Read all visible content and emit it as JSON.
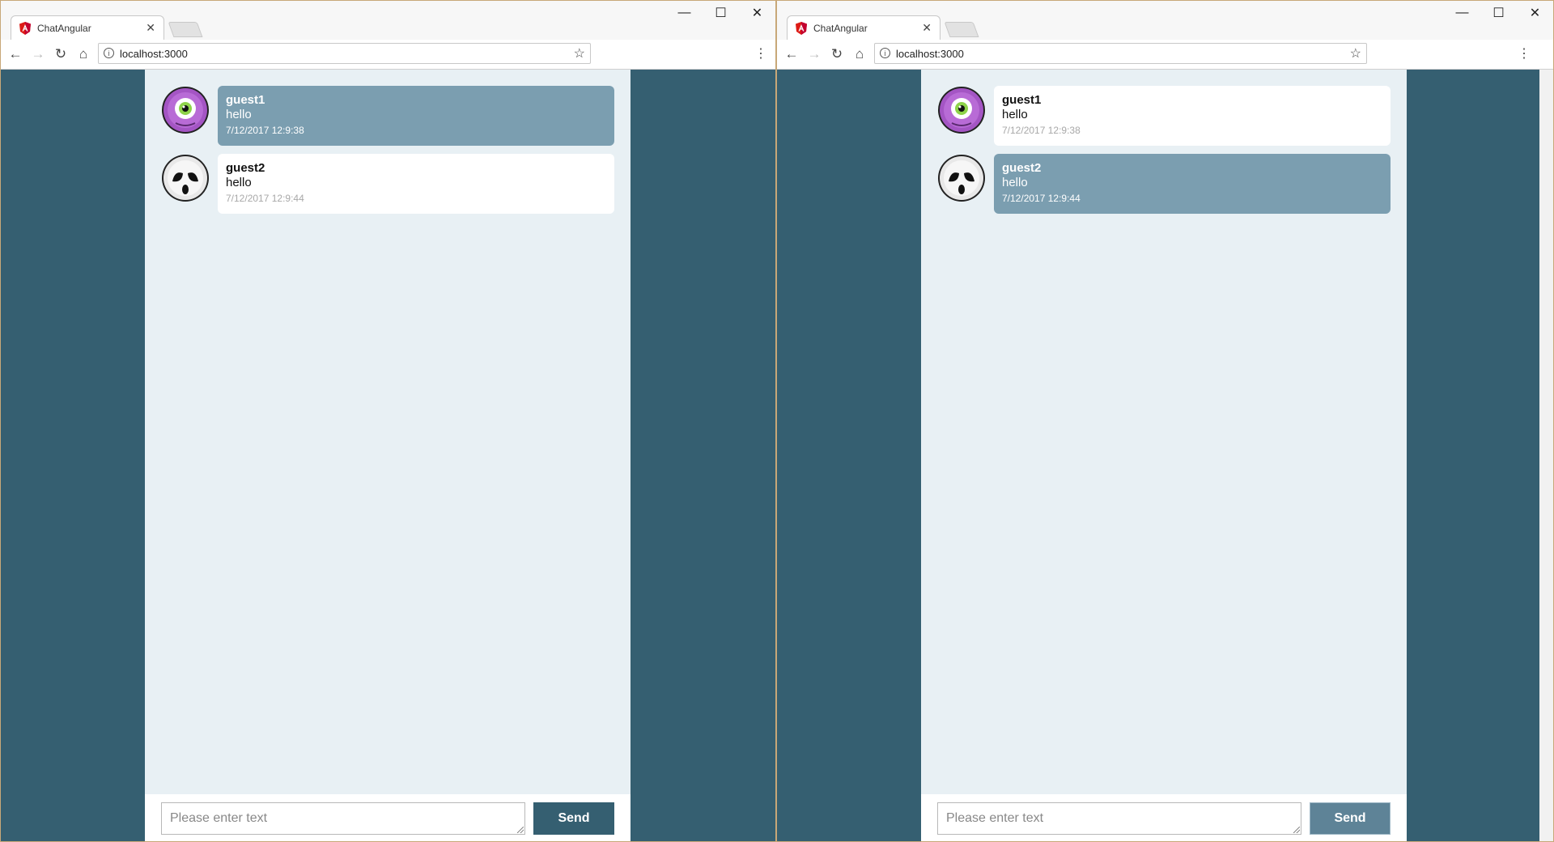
{
  "colors": {
    "page_background": "#355f71",
    "chat_background": "#e8f0f4",
    "own_bubble": "#7b9eb0",
    "other_bubble": "#ffffff",
    "send_button_dark": "#355f71",
    "send_button_light": "#5e8397"
  },
  "windows": [
    {
      "tab": {
        "title": "ChatAngular",
        "icon": "angular-logo-icon"
      },
      "address": {
        "url": "localhost:3000"
      },
      "messages": [
        {
          "user": "guest1",
          "text": "hello",
          "time": "7/12/2017 12:9:38",
          "style": "self",
          "avatar": "purple-cyclops-avatar"
        },
        {
          "user": "guest2",
          "text": "hello",
          "time": "7/12/2017 12:9:44",
          "style": "other",
          "avatar": "ghost-mask-avatar"
        }
      ],
      "composer": {
        "placeholder": "Please enter text",
        "send_label": "Send"
      }
    },
    {
      "tab": {
        "title": "ChatAngular",
        "icon": "angular-logo-icon"
      },
      "address": {
        "url": "localhost:3000"
      },
      "messages": [
        {
          "user": "guest1",
          "text": "hello",
          "time": "7/12/2017 12:9:38",
          "style": "other",
          "avatar": "purple-cyclops-avatar"
        },
        {
          "user": "guest2",
          "text": "hello",
          "time": "7/12/2017 12:9:44",
          "style": "self",
          "avatar": "ghost-mask-avatar"
        }
      ],
      "composer": {
        "placeholder": "Please enter text",
        "send_label": "Send"
      }
    }
  ]
}
